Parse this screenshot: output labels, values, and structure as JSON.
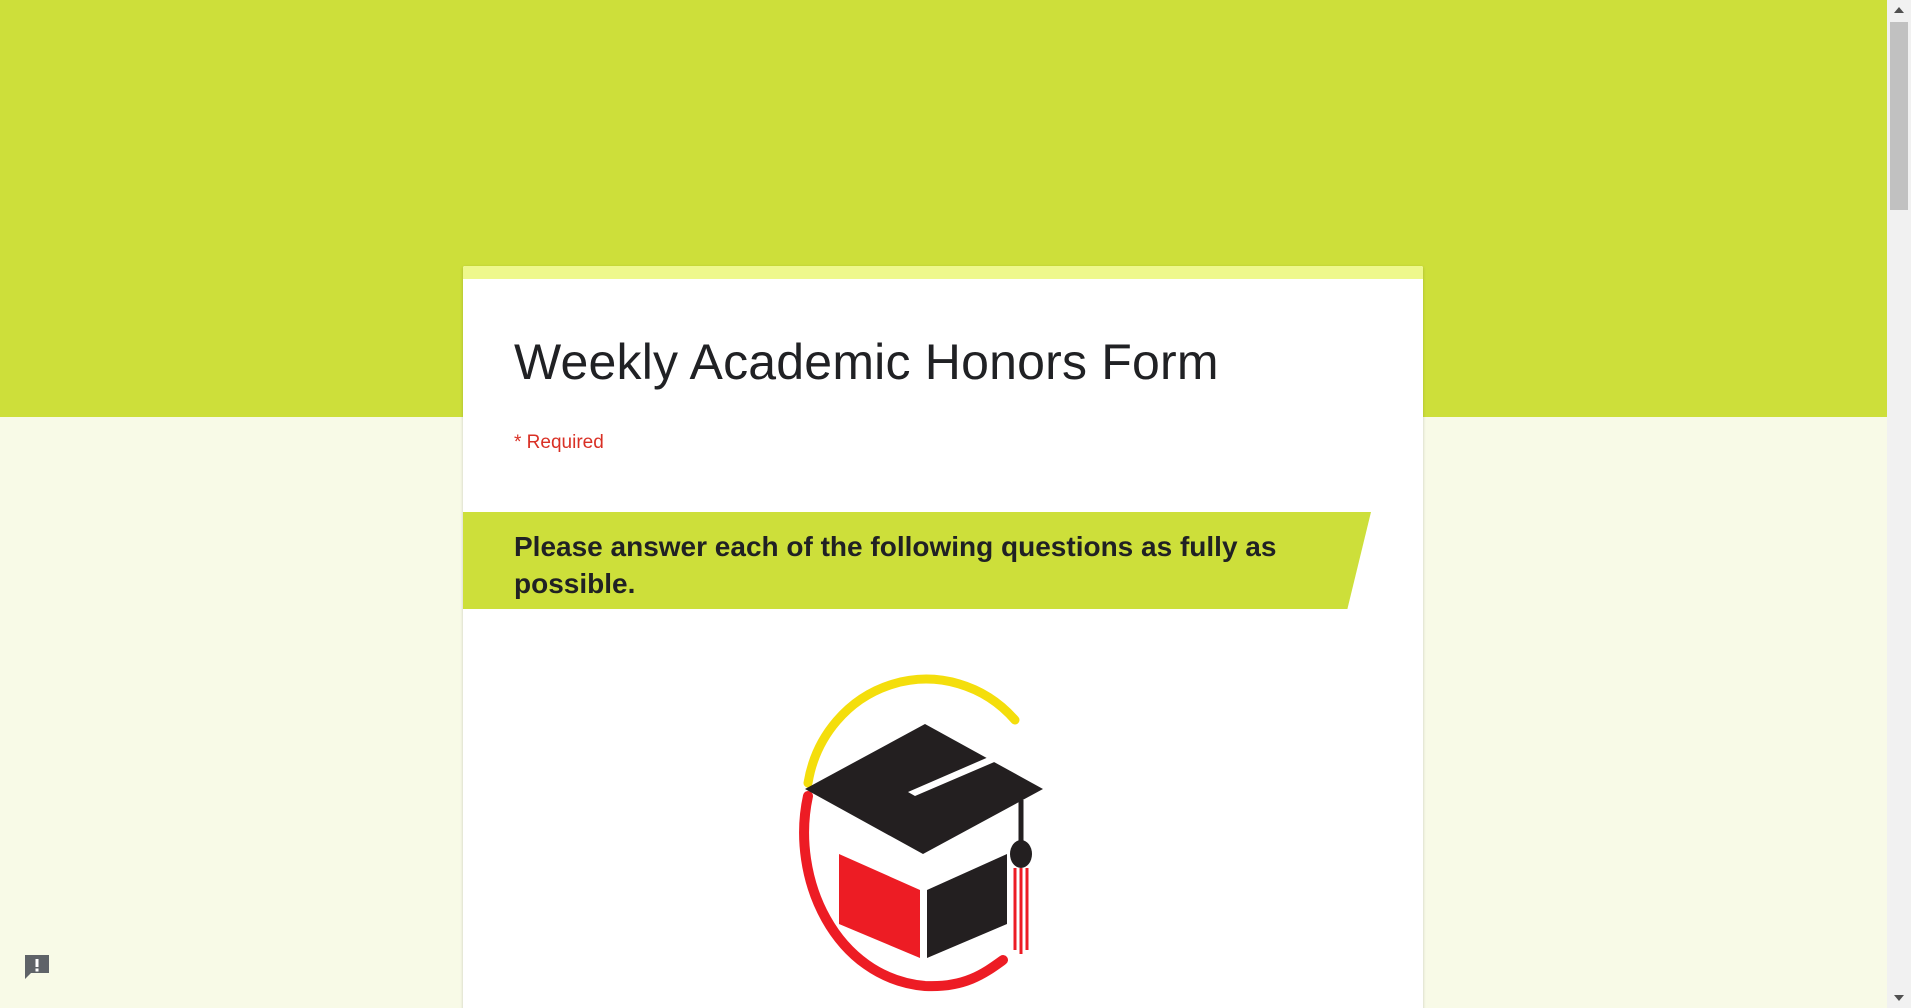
{
  "form": {
    "title": "Weekly Academic Honors Form",
    "required_note": "* Required",
    "section_header": "Please answer each of the following questions as fully as possible."
  },
  "icons": {
    "logo": "graduation-cap-logo",
    "feedback": "report-problem-icon",
    "scroll_up": "arrow-up-icon",
    "scroll_down": "arrow-down-icon"
  },
  "colors": {
    "header_band": "#cddf3a",
    "page_background": "#f8fae7",
    "card_accent": "#eef88c",
    "required_text": "#d93025",
    "logo_red": "#ed1c24",
    "logo_yellow": "#f4de0c",
    "logo_black": "#231f20"
  }
}
